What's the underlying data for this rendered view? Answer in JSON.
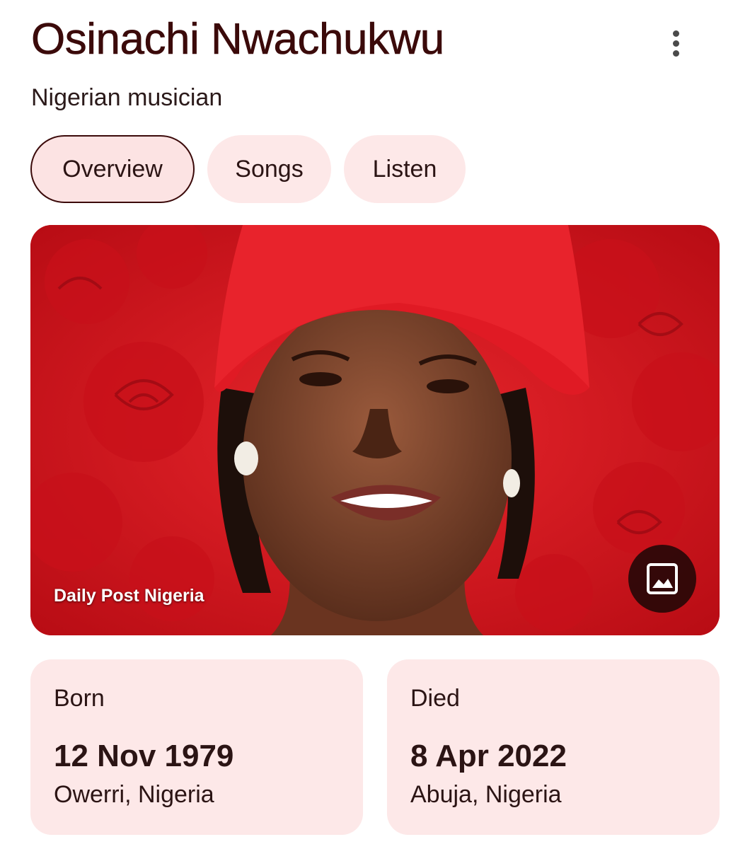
{
  "header": {
    "title": "Osinachi Nwachukwu",
    "subtitle": "Nigerian musician",
    "more_icon": "more-vert-icon"
  },
  "tabs": [
    {
      "label": "Overview",
      "active": true
    },
    {
      "label": "Songs",
      "active": false
    },
    {
      "label": "Listen",
      "active": false
    }
  ],
  "hero": {
    "source": "Daily Post Nigeria",
    "image_icon": "image-icon"
  },
  "facts": {
    "born": {
      "label": "Born",
      "date": "12 Nov 1979",
      "place": "Owerri, Nigeria"
    },
    "died": {
      "label": "Died",
      "date": "8 Apr 2022",
      "place": "Abuja, Nigeria"
    }
  },
  "colors": {
    "title": "#3b0a0a",
    "chip_bg": "#fde8e8",
    "card_bg": "#fde8e8",
    "photo_red": "#d8141c"
  }
}
